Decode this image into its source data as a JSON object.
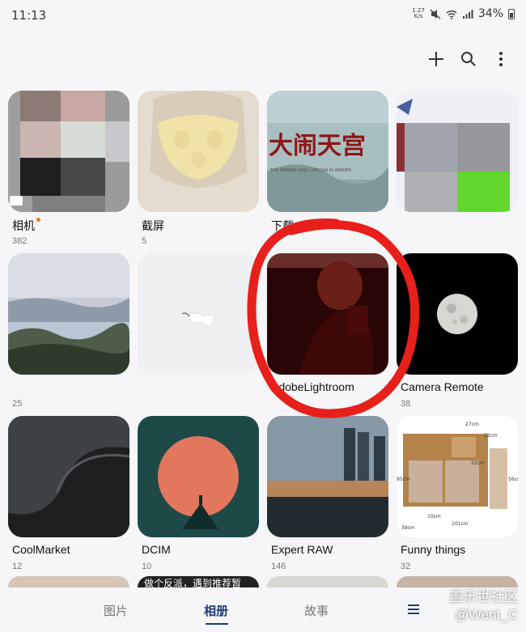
{
  "status_bar": {
    "time": "11:13",
    "net_speed_value": "1.27",
    "net_speed_unit": "K/s",
    "battery": "34%"
  },
  "albums": [
    {
      "name": "相机",
      "count": "382",
      "has_dot": true
    },
    {
      "name": "截屏",
      "count": "5"
    },
    {
      "name": "下载",
      "count": ""
    },
    {
      "name": "",
      "count": ""
    },
    {
      "name": "",
      "count": "25"
    },
    {
      "name": "",
      "count": ""
    },
    {
      "name": "AdobeLightroom",
      "count": ""
    },
    {
      "name": "Camera Remote",
      "count": "38"
    },
    {
      "name": "CoolMarket",
      "count": "12"
    },
    {
      "name": "DCIM",
      "count": "10"
    },
    {
      "name": "Expert RAW",
      "count": "146"
    },
    {
      "name": "Funny things",
      "count": "32"
    }
  ],
  "thumbnails": {
    "downloads_banner_text": "大闹天宫",
    "downloads_banner_sub": "THE MONKEY KING: UPROAR IN HEAVEN",
    "next_row_banner_text": "做个反派，遇到推荐暂"
  },
  "furniture_dims": [
    "27cm",
    "12cm",
    "22cm",
    "95cm",
    "56cm",
    "101cm",
    "39cm",
    "10cm"
  ],
  "bottom_nav": {
    "tabs": [
      "图片",
      "相册",
      "故事"
    ],
    "active_tab": "相册"
  },
  "watermark": {
    "line1": "盖乐世社区",
    "line2": "@Went_C"
  },
  "colors": {
    "accent": "#1f3a78",
    "annotation_red": "#e8201b",
    "notification_dot": "#f07a1c"
  }
}
